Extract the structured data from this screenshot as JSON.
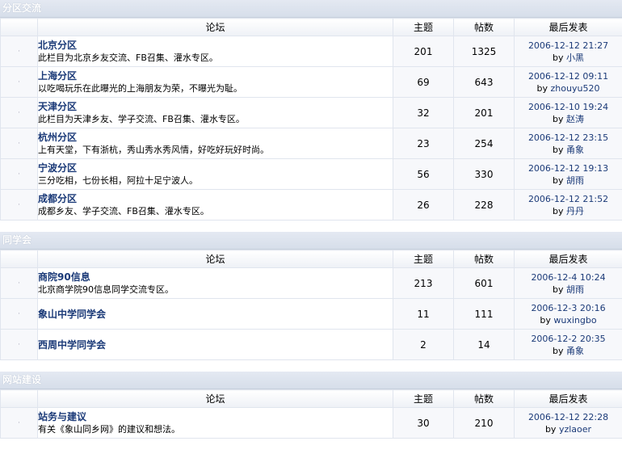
{
  "headers": {
    "forum": "论坛",
    "topics": "主题",
    "posts": "帖数",
    "last": "最后发表",
    "by_prefix": "by "
  },
  "icon_glyph": "·",
  "sections": [
    {
      "title": "分区交流",
      "forums": [
        {
          "name": "北京分区",
          "desc": "此栏目为北京乡友交流、FB召集、灌水专区。",
          "topics": "201",
          "posts": "1325",
          "date": "2006-12-12 21:27",
          "user": "小黑"
        },
        {
          "name": "上海分区",
          "desc": "以吃喝玩乐在此曝光的上海朋友为荣，不曝光为耻。",
          "topics": "69",
          "posts": "643",
          "date": "2006-12-12 09:11",
          "user": "zhouyu520"
        },
        {
          "name": "天津分区",
          "desc": "此栏目为天津乡友、学子交流、FB召集、灌水专区。",
          "topics": "32",
          "posts": "201",
          "date": "2006-12-10 19:24",
          "user": "赵涛"
        },
        {
          "name": "杭州分区",
          "desc": "上有天堂，下有浙杭，秀山秀水秀风情，好吃好玩好时尚。",
          "topics": "23",
          "posts": "254",
          "date": "2006-12-12 23:15",
          "user": "甬象"
        },
        {
          "name": "宁波分区",
          "desc": "三分吃相，七份长相，阿拉十足宁波人。",
          "topics": "56",
          "posts": "330",
          "date": "2006-12-12 19:13",
          "user": "胡雨"
        },
        {
          "name": "成都分区",
          "desc": "成都乡友、学子交流、FB召集、灌水专区。",
          "topics": "26",
          "posts": "228",
          "date": "2006-12-12 21:52",
          "user": "丹丹"
        }
      ]
    },
    {
      "title": "同学会",
      "forums": [
        {
          "name": "商院90信息",
          "desc": "北京商学院90信息同学交流专区。",
          "topics": "213",
          "posts": "601",
          "date": "2006-12-4 10:24",
          "user": "胡雨"
        },
        {
          "name": "象山中学同学会",
          "desc": "",
          "topics": "11",
          "posts": "111",
          "date": "2006-12-3 20:16",
          "user": "wuxingbo"
        },
        {
          "name": "西周中学同学会",
          "desc": "",
          "topics": "2",
          "posts": "14",
          "date": "2006-12-2 20:35",
          "user": "甬象"
        }
      ]
    },
    {
      "title": "网站建设",
      "forums": [
        {
          "name": "站务与建议",
          "desc": "有关《象山同乡网》的建议和想法。",
          "topics": "30",
          "posts": "210",
          "date": "2006-12-12 22:28",
          "user": "yzlaoer"
        }
      ]
    }
  ]
}
